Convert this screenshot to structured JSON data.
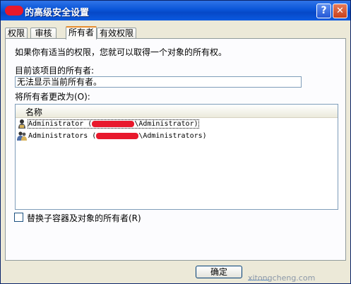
{
  "window": {
    "title": "的高级安全设置"
  },
  "tabs": [
    "权限",
    "审核",
    "所有者",
    "有效权限"
  ],
  "active_tab": 2,
  "panel": {
    "description": "如果你有适当的权限，您就可以取得一个对象的所有权。",
    "current_owner_label": "目前该项目的所有者:",
    "current_owner_value": "无法显示当前所有者。",
    "change_owner_label": "将所有者更改为(O):",
    "list_header": "名称",
    "entries": [
      {
        "prefix": "Administrator (",
        "suffix": "\\Administrator)",
        "icon": "user-icon"
      },
      {
        "prefix": "Administrators (",
        "suffix": "\\Administrators)",
        "icon": "group-icon"
      }
    ],
    "replace_label": "替换子容器及对象的所有者(R)"
  },
  "buttons": {
    "ok": "确定"
  },
  "watermark": "xitongcheng.com"
}
